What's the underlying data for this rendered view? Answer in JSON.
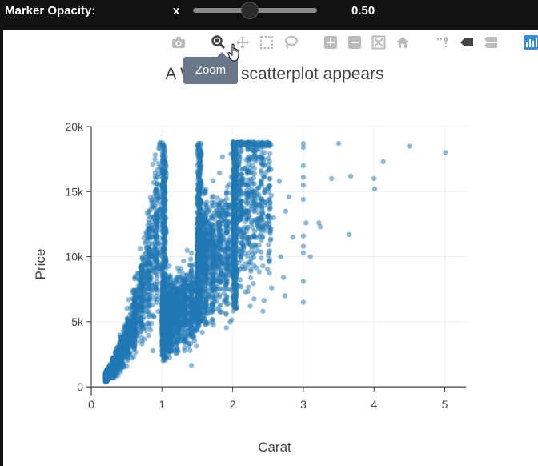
{
  "controls": {
    "opacity_label": "Marker Opacity:",
    "x_label": "x",
    "opacity_value": "0.50",
    "slider_value": 0.5
  },
  "modebar": {
    "tooltip": "Zoom",
    "icons": [
      "camera-icon",
      "zoom-icon",
      "pan-icon",
      "box-select-icon",
      "lasso-select-icon",
      "zoom-in-icon",
      "zoom-out-icon",
      "autoscale-icon",
      "reset-axes-icon",
      "spike-lines-icon",
      "hover-closest-icon",
      "hover-compare-icon",
      "plotly-logo-icon"
    ]
  },
  "chart_data": {
    "type": "scatter",
    "title": "A WebGL scatterplot appears",
    "xlabel": "Carat",
    "ylabel": "Price",
    "xlim": [
      0,
      5.3
    ],
    "ylim": [
      -300,
      20000
    ],
    "xticks": [
      0,
      1,
      2,
      3,
      4,
      5
    ],
    "xtick_labels": [
      "0",
      "1",
      "2",
      "3",
      "4",
      "5"
    ],
    "yticks": [
      0,
      5000,
      10000,
      15000,
      20000
    ],
    "ytick_labels": [
      "0",
      "5k",
      "10k",
      "15k",
      "20k"
    ],
    "grid": true,
    "marker_color": "#1f77b4",
    "marker_opacity": 0.5,
    "outliers": [
      {
        "x": 3.0,
        "y": 18700
      },
      {
        "x": 3.0,
        "y": 18400
      },
      {
        "x": 3.0,
        "y": 17000
      },
      {
        "x": 3.0,
        "y": 16100
      },
      {
        "x": 3.0,
        "y": 15500
      },
      {
        "x": 3.0,
        "y": 14400
      },
      {
        "x": 3.0,
        "y": 11600
      },
      {
        "x": 3.0,
        "y": 10800
      },
      {
        "x": 3.0,
        "y": 10300
      },
      {
        "x": 3.0,
        "y": 8100
      },
      {
        "x": 3.0,
        "y": 6500
      },
      {
        "x": 3.04,
        "y": 12600
      },
      {
        "x": 3.1,
        "y": 10000
      },
      {
        "x": 3.22,
        "y": 12600
      },
      {
        "x": 3.24,
        "y": 12300
      },
      {
        "x": 3.4,
        "y": 16000
      },
      {
        "x": 3.5,
        "y": 18700
      },
      {
        "x": 3.65,
        "y": 11700
      },
      {
        "x": 3.67,
        "y": 16200
      },
      {
        "x": 4.0,
        "y": 16000
      },
      {
        "x": 4.01,
        "y": 15200
      },
      {
        "x": 4.13,
        "y": 17300
      },
      {
        "x": 4.5,
        "y": 18500
      },
      {
        "x": 5.01,
        "y": 18000
      },
      {
        "x": 2.52,
        "y": 9600
      },
      {
        "x": 2.55,
        "y": 7600
      },
      {
        "x": 2.68,
        "y": 10000
      },
      {
        "x": 2.72,
        "y": 8400
      },
      {
        "x": 2.75,
        "y": 13500
      },
      {
        "x": 2.8,
        "y": 14600
      },
      {
        "x": 2.66,
        "y": 15800
      },
      {
        "x": 2.74,
        "y": 7000
      },
      {
        "x": 2.58,
        "y": 13000
      },
      {
        "x": 2.85,
        "y": 11500
      }
    ]
  }
}
